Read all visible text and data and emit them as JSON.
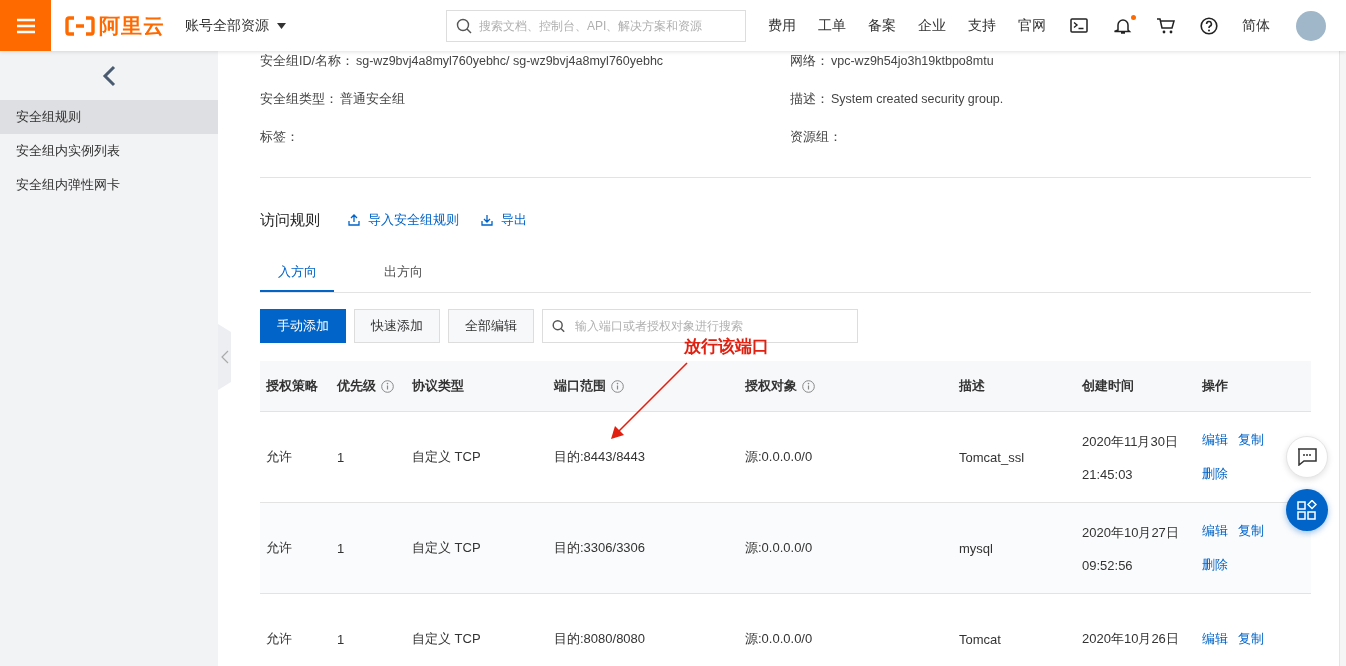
{
  "header": {
    "brand": "阿里云",
    "account_menu": "账号全部资源",
    "search": {
      "placeholder": "搜索文档、控制台、API、解决方案和资源"
    },
    "nav": [
      "费用",
      "工单",
      "备案",
      "企业",
      "支持",
      "官网"
    ],
    "notifications_unread": true,
    "language": "简体"
  },
  "sidebar": {
    "items": [
      {
        "label": "安全组规则",
        "selected": true
      },
      {
        "label": "安全组内实例列表",
        "selected": false
      },
      {
        "label": "安全组内弹性网卡",
        "selected": false
      }
    ]
  },
  "details": {
    "left": [
      {
        "label": "安全组ID/名称：",
        "value": "sg-wz9bvj4a8myl760yebhc/ sg-wz9bvj4a8myl760yebhc"
      },
      {
        "label": "安全组类型：",
        "value": "普通安全组"
      },
      {
        "label": "标签："
      }
    ],
    "right": [
      {
        "label": "网络：",
        "value": "vpc-wz9h54jo3h19ktbpo8mtu"
      },
      {
        "label": "描述：",
        "value": "System created security group."
      },
      {
        "label": "资源组："
      }
    ]
  },
  "rules": {
    "title": "访问规则",
    "actions": [
      {
        "kind": "import",
        "label": "导入安全组规则"
      },
      {
        "kind": "export",
        "label": "导出"
      }
    ],
    "tabs": [
      {
        "label": "入方向",
        "selected": true
      },
      {
        "label": "出方向",
        "selected": false
      }
    ],
    "buttons": [
      {
        "label": "手动添加",
        "primary": true
      },
      {
        "label": "快速添加",
        "primary": false
      },
      {
        "label": "全部编辑",
        "primary": false
      }
    ],
    "search": {
      "placeholder": "输入端口或者授权对象进行搜索"
    },
    "columns": [
      {
        "label": "授权策略",
        "info": false
      },
      {
        "label": "优先级",
        "info": true
      },
      {
        "label": "协议类型",
        "info": false
      },
      {
        "label": "端口范围",
        "info": true
      },
      {
        "label": "授权对象",
        "info": true
      },
      {
        "label": "描述",
        "info": false
      },
      {
        "label": "创建时间",
        "info": false
      },
      {
        "label": "操作",
        "info": false
      }
    ],
    "rows": [
      {
        "policy": "允许",
        "priority": "1",
        "protocol": "自定义 TCP",
        "ports": "目的:8443/8443",
        "source": "源:0.0.0.0/0",
        "description": "Tomcat_ssl",
        "created": [
          "2020年11月30日",
          "21:45:03"
        ],
        "actions": [
          "编辑",
          "复制",
          "删除"
        ]
      },
      {
        "policy": "允许",
        "priority": "1",
        "protocol": "自定义 TCP",
        "ports": "目的:3306/3306",
        "source": "源:0.0.0.0/0",
        "description": "mysql",
        "created": [
          "2020年10月27日",
          "09:52:56"
        ],
        "actions": [
          "编辑",
          "复制",
          "删除"
        ]
      },
      {
        "policy": "允许",
        "priority": "1",
        "protocol": "自定义 TCP",
        "ports": "目的:8080/8080",
        "source": "源:0.0.0.0/0",
        "description": "Tomcat",
        "created": [
          "2020年10月26日"
        ],
        "actions": [
          "编辑",
          "复制"
        ]
      }
    ]
  },
  "annotation": {
    "text": "放行该端口"
  }
}
